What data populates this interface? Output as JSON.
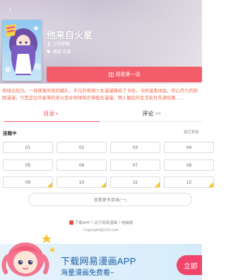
{
  "header": {
    "title": "他来自火星",
    "author": "三剑伊面",
    "tags": "搞笑 恋爱",
    "read_button": "观看第一话",
    "cover_alt_text": "他来自火星"
  },
  "description": "地球沦陷日。一场匪夷所思的婚礼，平凡的地球少女漫漫嫁给了卡修。卡修温柔体贴，尽心尽力的照顾漫漫，只是这位外星来的老公恶补地球知识来配合漫漫，两人婚后的生活处处充满惊喜……",
  "tabs": {
    "catalog_label": "目录",
    "catalog_arrow": "▾",
    "comment_label": "评论",
    "comment_count": "349"
  },
  "status": "连载中",
  "sort_label": "最近更新",
  "chapters": [
    {
      "label": "01",
      "locked": false
    },
    {
      "label": "02",
      "locked": false
    },
    {
      "label": "03",
      "locked": false
    },
    {
      "label": "04",
      "locked": false
    },
    {
      "label": "05",
      "locked": false
    },
    {
      "label": "06",
      "locked": false
    },
    {
      "label": "07",
      "locked": false
    },
    {
      "label": "08",
      "locked": false
    },
    {
      "label": "09",
      "locked": true
    },
    {
      "label": "10",
      "locked": true
    },
    {
      "label": "11",
      "locked": true
    },
    {
      "label": "12",
      "locked": true
    }
  ],
  "more_label": "查看更多目录(一)",
  "footer": {
    "download_link": "下载APP",
    "about_link": "关于网易漫画",
    "desktop_link": "电脑版",
    "separator": "|",
    "copyright": "Copyright@163.com"
  },
  "banner": {
    "title": "下载网易漫画APP",
    "subtitle": "海量漫画免费看~",
    "button_label": "立即"
  },
  "colors": {
    "accent": "#f35d69",
    "description": "#f06a4e",
    "banner_text": "#1b5ea6",
    "lock_badge": "#f5c430"
  }
}
